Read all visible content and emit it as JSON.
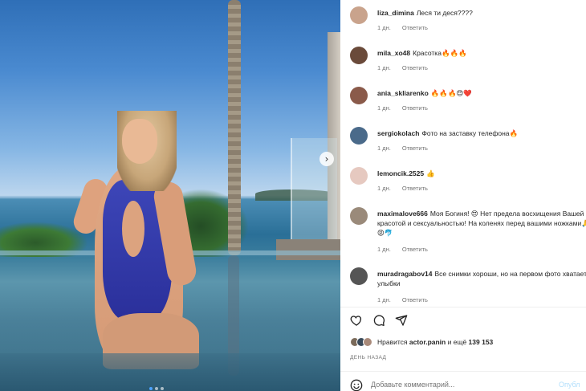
{
  "media": {
    "next_icon": "chevron-right-icon"
  },
  "comments": [
    {
      "user": "liza_dimina",
      "text": "Леся ти деся????",
      "time": "1 дн.",
      "reply": "Ответить",
      "avatar_color": "#c9a38c"
    },
    {
      "user": "mila_xo48",
      "text": "Красотка🔥🔥🔥",
      "time": "1 дн.",
      "reply": "Ответить",
      "avatar_color": "#6a4a3a"
    },
    {
      "user": "ania_skliarenko",
      "text": "🔥🔥🔥😍❤️",
      "time": "1 дн.",
      "reply": "Ответить",
      "avatar_color": "#8a5a4a"
    },
    {
      "user": "sergiokolach",
      "text": "Фото на заставку телефона🔥",
      "time": "1 дн.",
      "reply": "Ответить",
      "avatar_color": "#4a6a8a"
    },
    {
      "user": "lemoncik.2525",
      "text": "👍",
      "time": "1 дн.",
      "reply": "Ответить",
      "avatar_color": "#e6c9c0"
    },
    {
      "user": "maximalove666",
      "text": "Моя Богиня! 😍 Нет предела восхищения Вашей красотой и сексуальностью! На коленях перед вашими ножками🙏😡🐬",
      "time": "1 дн.",
      "reply": "Ответить",
      "avatar_color": "#9a8a7a"
    },
    {
      "user": "muradragabov14",
      "text": "Все снимки хороши, но на первом фото хватает улыбки",
      "time": "1 дн.",
      "reply": "Ответить",
      "avatar_color": "#555555"
    }
  ],
  "actions": {
    "like_icon": "heart-icon",
    "comment_icon": "comment-icon",
    "share_icon": "share-icon"
  },
  "likes": {
    "prefix": "Нравится",
    "user": "actor.panin",
    "suffix": "и ещё",
    "count": "139 153"
  },
  "timestamp": "ДЕНЬ НАЗАД",
  "composer": {
    "placeholder": "Добавьте комментарий...",
    "publish_label": "Опубл"
  }
}
